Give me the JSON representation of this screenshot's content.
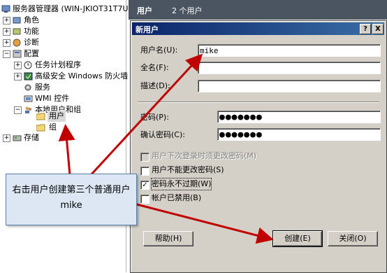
{
  "tree": {
    "root_label": "服务器管理器 (WIN-JKIOT31T7U",
    "items": [
      {
        "label": "角色"
      },
      {
        "label": "功能"
      },
      {
        "label": "诊断"
      },
      {
        "label": "配置"
      },
      {
        "label": "任务计划程序"
      },
      {
        "label": "高级安全 Windows 防火墙"
      },
      {
        "label": "服务"
      },
      {
        "label": "WMI 控件"
      },
      {
        "label": "本地用户和组"
      },
      {
        "label": "用户"
      },
      {
        "label": "组"
      },
      {
        "label": "存储"
      }
    ],
    "expander_plus": "+",
    "expander_minus": "−"
  },
  "header": {
    "title": "用户",
    "count": "2 个用户"
  },
  "dialog": {
    "title": "新用户",
    "help_btn": "?",
    "close_btn": "X",
    "username_label": "用户名(U):",
    "username_value": "mike",
    "fullname_label": "全名(F):",
    "fullname_value": "",
    "desc_label": "描述(D):",
    "desc_value": "",
    "password_label": "密码(P):",
    "password_value": "●●●●●●●",
    "confirm_label": "确认密码(C):",
    "confirm_value": "●●●●●●●",
    "options": [
      {
        "label": "用户下次登录时须更改密码(M)",
        "checked": false,
        "disabled": true
      },
      {
        "label": "用户不能更改密码(S)",
        "checked": false,
        "disabled": false
      },
      {
        "label": "密码永不过期(W)",
        "checked": true,
        "disabled": false
      },
      {
        "label": "帐户已禁用(B)",
        "checked": false,
        "disabled": false
      }
    ],
    "check_mark": "✓",
    "help_button": "帮助(H)",
    "create_button": "创建(E)",
    "close_button": "关闭(O)"
  },
  "callout": {
    "text": "右击用户创建第三个普通用户mike"
  },
  "colors": {
    "arrow": "#c00000",
    "title_bar": "#0a246a",
    "callout_bg": "#dde7f4"
  }
}
